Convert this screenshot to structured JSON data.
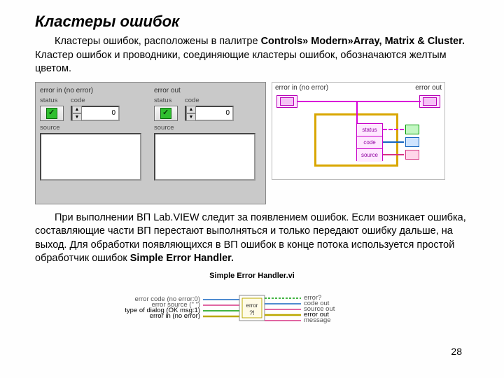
{
  "title": "Кластеры ошибок",
  "para1_a": "Кластеры ошибок, расположены в палитре  ",
  "para1_b": "Controls» Modern»Array, Matrix & Cluster.",
  "para1_c": " Кластер ошибок и проводники, соединяющие кластеры ошибок, обозначаются желтым цветом.",
  "para2_a": "При выполнении ВП Lab.VIEW следит за появлением ошибок. Если возникает ошибка, составляющие части ВП перестают выполняться и только передают ошибку дальше, на выход. Для обработки появляющихся в ВП ошибок в конце потока используется простой обработчик ошибок ",
  "para2_b": "Simple Error Handler.",
  "fp": {
    "grp1_title": "error in (no error)",
    "grp2_title": "error out",
    "status_label": "status",
    "code_label": "code",
    "source_label": "source",
    "code1": "0",
    "code2": "0",
    "up": "▲",
    "down": "▼"
  },
  "bd": {
    "in_label": "error in (no error)",
    "out_label": "error out",
    "status": "status",
    "code": "code",
    "source": "source"
  },
  "bottom": {
    "title": "Simple Error Handler.vi",
    "l1": "error code (no error:0)",
    "l2": "error source (\" \")",
    "l3": "type of dialog (OK msg:1)",
    "l4": "error in (no error)",
    "r1": "error?",
    "r2": "code out",
    "r3": "source out",
    "r4": "error out",
    "r5": "message",
    "icon": "error?!"
  },
  "page": "28"
}
